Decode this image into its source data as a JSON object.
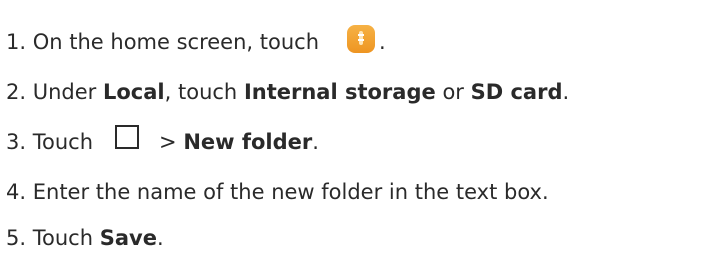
{
  "steps": [
    {
      "num": "1.",
      "text": "On the home screen, touch",
      "end": "."
    },
    {
      "num": "2.",
      "a": "Under",
      "b": "Local",
      "c": ", touch",
      "d": "Internal storage",
      "e": "or",
      "f": "SD card",
      "g": "."
    },
    {
      "num": "3.",
      "a": "Touch",
      "b": ">",
      "c": "New folder",
      "d": "."
    },
    {
      "num": "4.",
      "text": "Enter the name of the new folder in the text box."
    },
    {
      "num": "5.",
      "a": "Touch",
      "b": "Save",
      "c": "."
    }
  ],
  "icons": {
    "files_app": "files-app-icon",
    "menu_square": "more-options-square-icon"
  },
  "colors": {
    "text": "#2a2a2a",
    "files_icon_orange": "#f2a535"
  }
}
